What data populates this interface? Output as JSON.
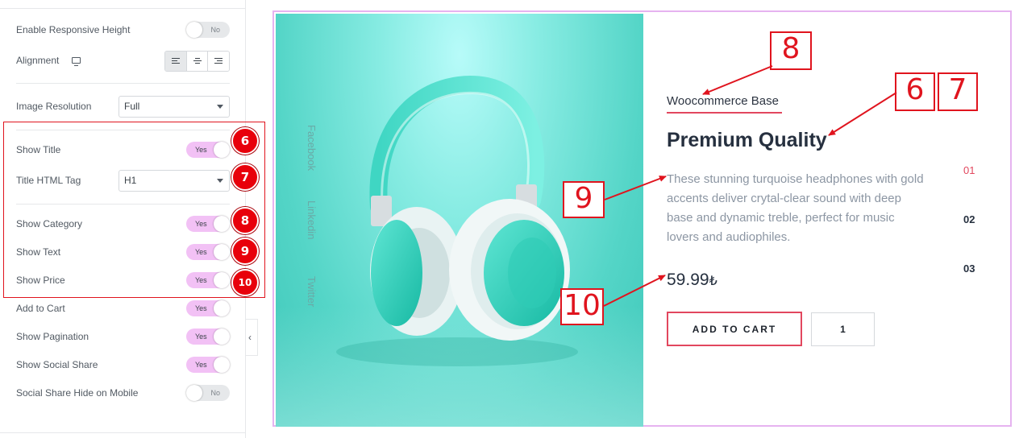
{
  "panel": {
    "responsive_height": {
      "label": "Enable Responsive Height",
      "value": "No"
    },
    "alignment": {
      "label": "Alignment",
      "device_icon": "desktop-monitor-icon",
      "options": [
        "align-left",
        "align-center",
        "align-right"
      ],
      "selected": "align-left"
    },
    "image_resolution": {
      "label": "Image Resolution",
      "value": "Full"
    },
    "show_title": {
      "label": "Show Title",
      "value": "Yes"
    },
    "title_html_tag": {
      "label": "Title HTML Tag",
      "value": "H1"
    },
    "show_category": {
      "label": "Show Category",
      "value": "Yes"
    },
    "show_text": {
      "label": "Show Text",
      "value": "Yes"
    },
    "show_price": {
      "label": "Show Price",
      "value": "Yes"
    },
    "add_to_cart": {
      "label": "Add to Cart",
      "value": "Yes"
    },
    "show_pagination": {
      "label": "Show Pagination",
      "value": "Yes"
    },
    "show_social_share": {
      "label": "Show Social Share",
      "value": "Yes"
    },
    "social_share_mobile": {
      "label": "Social Share Hide on Mobile",
      "value": "No"
    },
    "collapse_icon": "chevron-left-icon",
    "badges": [
      "6",
      "7",
      "8",
      "9",
      "10"
    ],
    "toggle_on_color": "#f2c1f5",
    "highlight_color": "#e0141e"
  },
  "preview": {
    "social": [
      "Facebook",
      "Linkedin",
      "Twitter"
    ],
    "category": "Woocommerce Base",
    "title": "Premium Quality",
    "description": "These stunning turquoise headphones with gold accents deliver crytal-clear sound with deep base and dynamic treble, perfect for music lovers and audiophiles.",
    "price": "59.99",
    "currency": "₺",
    "cart_button": "ADD TO CART",
    "quantity": "1",
    "pagination": [
      "01",
      "02",
      "03"
    ],
    "active_page": "01",
    "accent_color": "#e2475e",
    "frame_color": "#e6b3f0"
  },
  "annotations": {
    "box_8": "8",
    "box_6": "6",
    "box_7": "7",
    "box_9": "9",
    "box_10": "10"
  }
}
